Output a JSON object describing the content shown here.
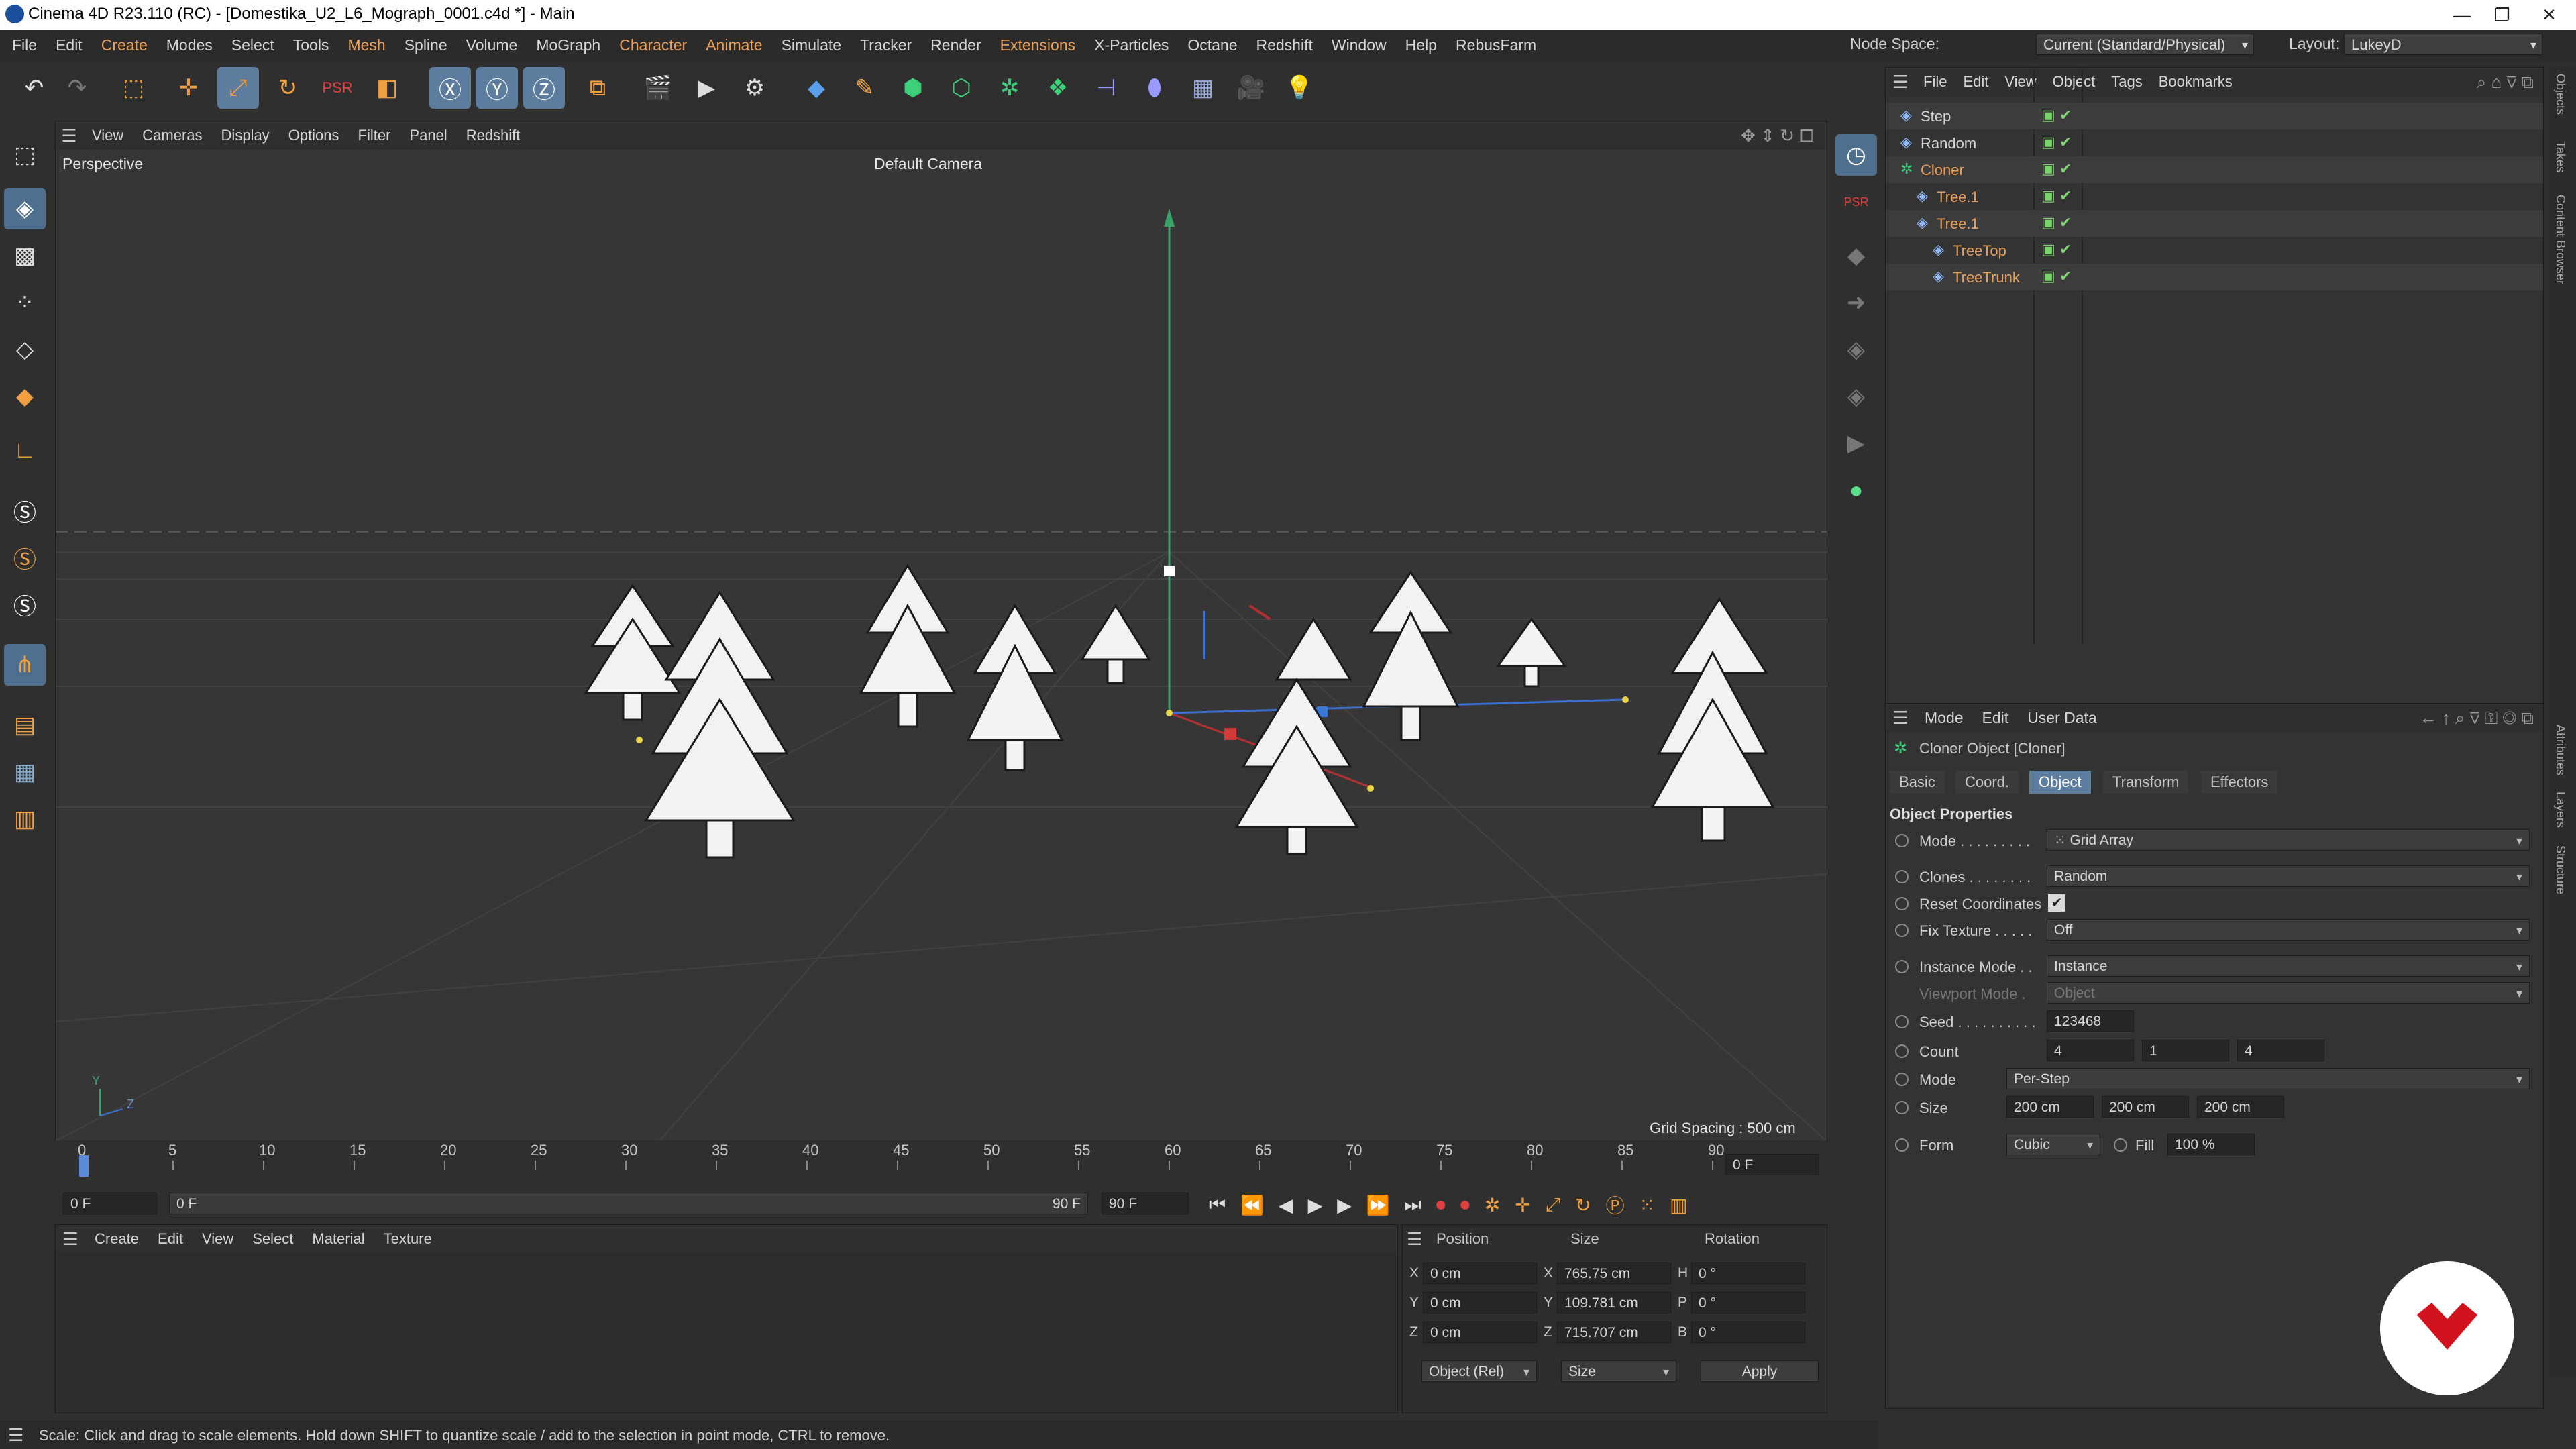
{
  "window": {
    "title": "Cinema 4D R23.110 (RC) - [Domestika_U2_L6_Mograph_0001.c4d *] - Main",
    "minimize": "—",
    "restore": "❐",
    "close": "✕"
  },
  "menu": [
    {
      "label": "File"
    },
    {
      "label": "Edit"
    },
    {
      "label": "Create",
      "orange": true
    },
    {
      "label": "Modes"
    },
    {
      "label": "Select"
    },
    {
      "label": "Tools"
    },
    {
      "label": "Mesh",
      "orange": true
    },
    {
      "label": "Spline"
    },
    {
      "label": "Volume"
    },
    {
      "label": "MoGraph"
    },
    {
      "label": "Character",
      "orange": true
    },
    {
      "label": "Animate",
      "orange": true
    },
    {
      "label": "Simulate"
    },
    {
      "label": "Tracker"
    },
    {
      "label": "Render"
    },
    {
      "label": "Extensions",
      "orange": true
    },
    {
      "label": "X-Particles"
    },
    {
      "label": "Octane"
    },
    {
      "label": "Redshift"
    },
    {
      "label": "Window"
    },
    {
      "label": "Help"
    },
    {
      "label": "RebusFarm"
    }
  ],
  "nodespace": {
    "label": "Node Space:",
    "value": "Current (Standard/Physical)"
  },
  "layout": {
    "label": "Layout:",
    "value": "LukeyD"
  },
  "viewport": {
    "menu": [
      "View",
      "Cameras",
      "Display",
      "Options",
      "Filter",
      "Panel",
      "Redshift"
    ],
    "name": "Perspective",
    "camera": "Default Camera",
    "grid_spacing": "Grid Spacing : 500 cm",
    "axis_y": "Y",
    "axis_z": "Z"
  },
  "objects": {
    "menu": [
      "File",
      "Edit",
      "View",
      "Object",
      "Tags",
      "Bookmarks"
    ],
    "items": [
      {
        "name": "Step",
        "indent": 0,
        "color": "#d6d6d6"
      },
      {
        "name": "Random",
        "indent": 0,
        "color": "#d6d6d6"
      },
      {
        "name": "Cloner",
        "indent": 0,
        "color": "#e8a15a"
      },
      {
        "name": "Tree.1",
        "indent": 1,
        "color": "#e8a15a"
      },
      {
        "name": "Tree.1",
        "indent": 1,
        "color": "#e8a15a"
      },
      {
        "name": "TreeTop",
        "indent": 2,
        "color": "#e8a15a"
      },
      {
        "name": "TreeTrunk",
        "indent": 2,
        "color": "#e8a15a"
      }
    ]
  },
  "side_tabs": [
    "Objects",
    "Takes",
    "Content Browser",
    "Attributes",
    "Layers",
    "Structure"
  ],
  "attributes": {
    "menu": [
      "Mode",
      "Edit",
      "User Data"
    ],
    "object_title": "Cloner Object [Cloner]",
    "tabs": [
      {
        "label": "Basic",
        "active": false
      },
      {
        "label": "Coord.",
        "active": false
      },
      {
        "label": "Object",
        "active": true
      },
      {
        "label": "Transform",
        "active": false
      },
      {
        "label": "Effectors",
        "active": false
      }
    ],
    "section": "Object Properties",
    "mode": {
      "label": "Mode . . . . . . . . .",
      "value": "Grid Array"
    },
    "clones": {
      "label": "Clones . . . . . . . .",
      "value": "Random"
    },
    "reset_coords": {
      "label": "Reset Coordinates",
      "checked": "✔"
    },
    "fix_texture": {
      "label": "Fix Texture . . . . .",
      "value": "Off"
    },
    "instance_mode": {
      "label": "Instance Mode . .",
      "value": "Instance"
    },
    "viewport_mode": {
      "label": "Viewport Mode .",
      "value": "Object"
    },
    "seed": {
      "label": "Seed . . . . . . . . . .",
      "value": "123468"
    },
    "count": {
      "label": "Count",
      "x": "4",
      "y": "1",
      "z": "4"
    },
    "mode2": {
      "label": "Mode",
      "value": "Per-Step"
    },
    "size": {
      "label": "Size",
      "x": "200 cm",
      "y": "200 cm",
      "z": "200 cm"
    },
    "form": {
      "label": "Form",
      "value": "Cubic"
    },
    "fill": {
      "label": "Fill",
      "value": "100 %"
    }
  },
  "timeline": {
    "ticks": [
      "0",
      "5",
      "10",
      "15",
      "20",
      "25",
      "30",
      "35",
      "40",
      "45",
      "50",
      "55",
      "60",
      "65",
      "70",
      "75",
      "80",
      "85",
      "90"
    ],
    "current_frame": "0 F",
    "start": "0 F",
    "range_start": "0 F",
    "range_end": "90 F",
    "end": "90 F"
  },
  "material_menu": [
    "Create",
    "Edit",
    "View",
    "Select",
    "Material",
    "Texture"
  ],
  "coordinates": {
    "headers": [
      "Position",
      "Size",
      "Rotation"
    ],
    "rows": [
      {
        "axis": "X",
        "pos": "0 cm",
        "saxis": "X",
        "size": "765.75 cm",
        "raxis": "H",
        "rot": "0 °"
      },
      {
        "axis": "Y",
        "pos": "0 cm",
        "saxis": "Y",
        "size": "109.781 cm",
        "raxis": "P",
        "rot": "0 °"
      },
      {
        "axis": "Z",
        "pos": "0 cm",
        "saxis": "Z",
        "size": "715.707 cm",
        "raxis": "B",
        "rot": "0 °"
      }
    ],
    "space": "Object (Rel)",
    "size_mode": "Size",
    "apply": "Apply"
  },
  "status": "Scale: Click and drag to scale elements. Hold down SHIFT to quantize scale / add to the selection in point mode, CTRL to remove.",
  "colors": {
    "accent": "#5d7d9e",
    "orange": "#e8a15a",
    "badge_red": "#d0131c"
  }
}
